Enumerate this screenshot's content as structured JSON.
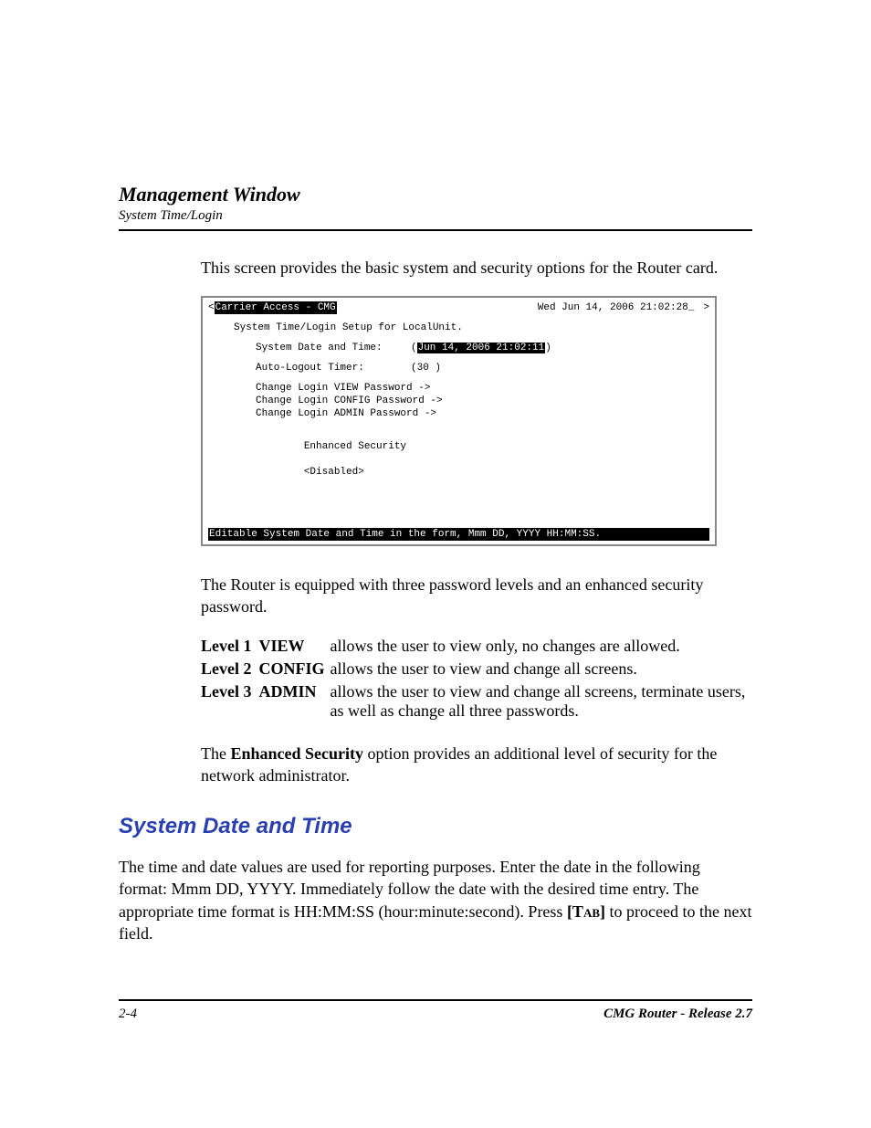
{
  "header": {
    "title": "Management Window",
    "subtitle": "System Time/Login"
  },
  "intro": "This screen provides the basic system and security options for the Router card.",
  "terminal": {
    "left_arrow": "<",
    "right_arrow": ">",
    "title": "Carrier Access - CMG",
    "datetime_header": "Wed Jun 14, 2006 21:02:28_",
    "subtitle": "System Time/Login Setup for LocalUnit.",
    "sys_date_label": "System Date and Time:",
    "sys_date_value": "Jun 14, 2006 21:02:11",
    "auto_logout_label": "Auto-Logout Timer:",
    "auto_logout_value": "(30 )",
    "change_view": "Change Login VIEW Password ->",
    "change_config": "Change Login CONFIG Password ->",
    "change_admin": "Change Login ADMIN Password ->",
    "enhanced_label": "Enhanced Security",
    "enhanced_value": "<Disabled>",
    "footer": "Editable  System Date and Time in the form, Mmm DD, YYYY HH:MM:SS."
  },
  "para2": "The Router is equipped with three password levels and an enhanced security password.",
  "levels": [
    {
      "lvl": "Level 1",
      "name": "VIEW",
      "desc": "allows the user to view only, no changes are allowed."
    },
    {
      "lvl": "Level 2",
      "name": "CONFIG",
      "desc": "allows the user to view and change all screens."
    },
    {
      "lvl": "Level 3",
      "name": "ADMIN",
      "desc": "allows the user to view and change all screens, terminate users, as well as change all three passwords."
    }
  ],
  "para3_a": "The ",
  "para3_bold": "Enhanced Security",
  "para3_b": " option provides an additional level of security for the network administrator.",
  "section_title": "System Date and Time",
  "section_body_a": "The time and date values are used for reporting purposes. Enter the date in the following format: Mmm DD, YYYY. Immediately follow the date with the desired time entry. The appropriate time format is HH:MM:SS (hour:minute:second). Press ",
  "tab_key": "[Tab]",
  "section_body_b": " to proceed to the next field.",
  "footer": {
    "page": "2-4",
    "product": "CMG Router - Release 2.7"
  }
}
